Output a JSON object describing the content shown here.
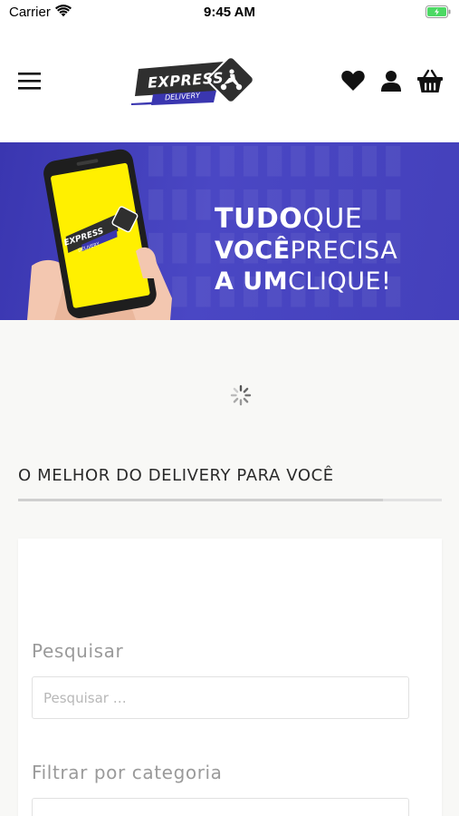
{
  "status_bar": {
    "carrier": "Carrier",
    "time": "9:45 AM"
  },
  "header": {
    "logo": {
      "primary_text": "EXPRESS",
      "secondary_text": "DELIVERY"
    },
    "icons": [
      "menu-icon",
      "heart-icon",
      "user-icon",
      "basket-icon"
    ]
  },
  "banner": {
    "phone_logo_primary": "EXPRESS",
    "phone_logo_secondary": "DELIVERY",
    "line1_bold": "TUDO",
    "line1_regular": "QUE",
    "line2_bold": "VOCÊ",
    "line2_regular": "PRECISA",
    "line3_bold": "A UM",
    "line3_regular": "CLIQUE!",
    "background_color": "#3f3cb8"
  },
  "main": {
    "section_title": "O MELHOR DO DELIVERY PARA VOCÊ",
    "search_label": "Pesquisar",
    "search_placeholder": "Pesquisar …",
    "category_label": "Filtrar por categoria",
    "category_value": ""
  },
  "colors": {
    "brand_dark": "#2f2f2f",
    "brand_blue": "#3a36b0",
    "phone_screen": "#fff000",
    "battery_green": "#4cd964"
  }
}
